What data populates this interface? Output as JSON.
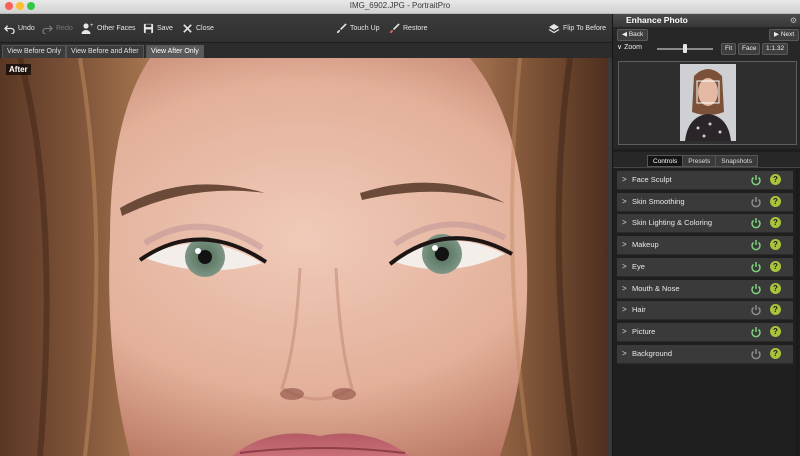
{
  "window": {
    "title": "IMG_6902.JPG - PortraitPro"
  },
  "toolbar": {
    "undo": "Undo",
    "redo": "Redo",
    "other_faces": "Other Faces",
    "save": "Save",
    "close": "Close",
    "touch_up": "Touch Up",
    "restore": "Restore",
    "flip": "Flip To Before"
  },
  "view_tabs": [
    "View Before Only",
    "View Before and After",
    "View After Only"
  ],
  "photo": {
    "badge": "After"
  },
  "panel": {
    "title": "Enhance Photo",
    "back": "Back",
    "next": "Next",
    "zoom_label": "Zoom",
    "zoom_level": 0.5,
    "fit": "Fit",
    "face": "Face",
    "ratio": "1:1.32",
    "tabs": [
      "Controls",
      "Presets",
      "Snapshots"
    ],
    "controls": [
      {
        "label": "Face Sculpt",
        "on": true
      },
      {
        "label": "Skin Smoothing",
        "on": false
      },
      {
        "label": "Skin Lighting & Coloring",
        "on": true
      },
      {
        "label": "Makeup",
        "on": true
      },
      {
        "label": "Eye",
        "on": true
      },
      {
        "label": "Mouth & Nose",
        "on": true
      },
      {
        "label": "Hair",
        "on": false
      },
      {
        "label": "Picture",
        "on": true
      },
      {
        "label": "Background",
        "on": false
      }
    ]
  },
  "colors": {
    "power_on": "#7ed27a",
    "power_off": "#8c8c8c",
    "help": "#a8c43a"
  }
}
